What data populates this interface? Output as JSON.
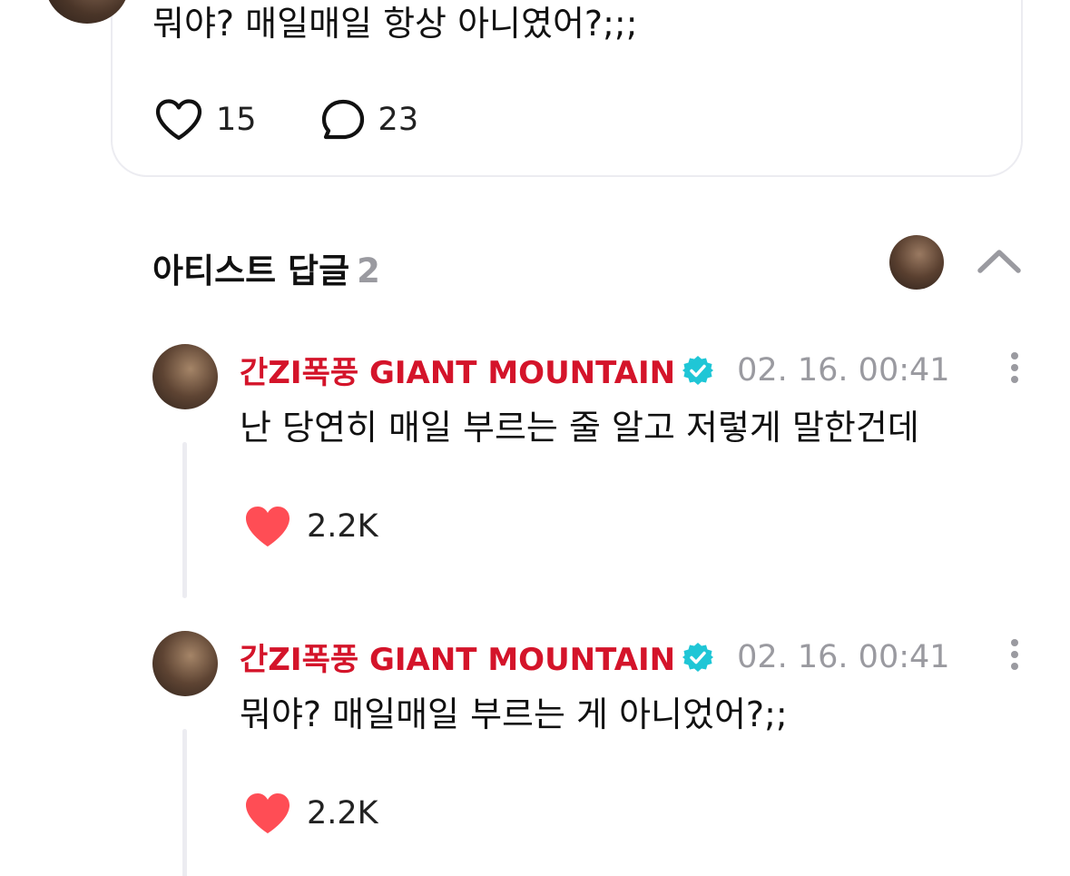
{
  "post": {
    "text": "뭐야? 매일매일 항상 아니였어?;;;",
    "likes": "15",
    "comments": "23"
  },
  "replies_section": {
    "title": "아티스트 답글",
    "count": "2"
  },
  "replies": [
    {
      "author": "간ZI폭풍 GIANT MOUNTAIN",
      "timestamp": "02. 16. 00:41",
      "text": "난 당연히 매일 부르는 줄 알고 저렇게 말한건데",
      "likes": "2.2K"
    },
    {
      "author": "간ZI폭풍 GIANT MOUNTAIN",
      "timestamp": "02. 16. 00:41",
      "text": "뭐야? 매일매일 부르는 게 아니었어?;;",
      "likes": "2.2K"
    }
  ],
  "colors": {
    "author": "#d4142a",
    "verified": "#1fc6d6",
    "like_active": "#ff4d55",
    "muted": "#9a9aa0"
  },
  "icons": {
    "like": "heart-outline-icon",
    "comment": "speech-bubble-icon",
    "collapse": "chevron-up-icon",
    "more": "vertical-dots-icon",
    "verified": "verified-badge-icon",
    "liked": "heart-filled-icon"
  }
}
